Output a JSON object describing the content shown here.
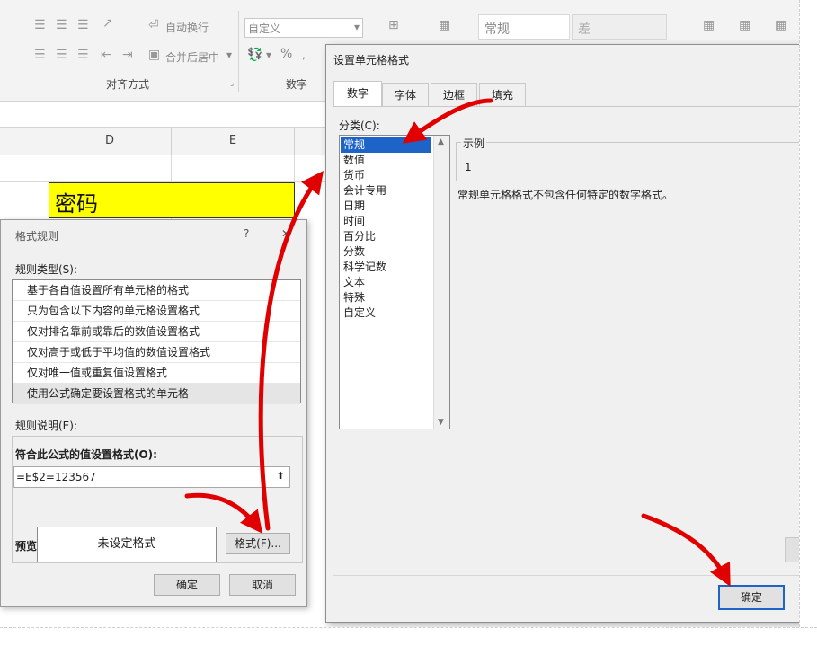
{
  "ribbon": {
    "wrap_text": "自动换行",
    "merge_center": "合并后居中",
    "format_select": "自定义",
    "percent": "%",
    "style_normal": "常规",
    "style_bad": "差",
    "group_alignment": "对齐方式",
    "group_number": "数字"
  },
  "sheet": {
    "columns": [
      "D",
      "E"
    ],
    "cell_d": "密码",
    "cell_fill": "#ffff00"
  },
  "cf_dialog": {
    "title": "格式规则",
    "help": "?",
    "close": "✕",
    "rule_type_label": "规则类型(S):",
    "rule_types": [
      "基于各自值设置所有单元格的格式",
      "只为包含以下内容的单元格设置格式",
      "仅对排名靠前或靠后的数值设置格式",
      "仅对高于或低于平均值的数值设置格式",
      "仅对唯一值或重复值设置格式",
      "使用公式确定要设置格式的单元格"
    ],
    "description_label": "规则说明(E):",
    "formula_label": "符合此公式的值设置格式(O):",
    "formula_value": "=E$2=123567",
    "preview_label": "预览:",
    "preview_text": "未设定格式",
    "format_button": "格式(F)...",
    "ok": "确定",
    "cancel": "取消"
  },
  "fmt_dialog": {
    "title": "设置单元格格式",
    "tabs": [
      "数字",
      "字体",
      "边框",
      "填充"
    ],
    "category_label": "分类(C):",
    "categories": [
      "常规",
      "数值",
      "货币",
      "会计专用",
      "日期",
      "时间",
      "百分比",
      "分数",
      "科学记数",
      "文本",
      "特殊",
      "自定义"
    ],
    "sample_label": "示例",
    "sample_value": "1",
    "description": "常规单元格格式不包含任何特定的数字格式。",
    "ok": "确定"
  },
  "colors": {
    "selection": "#1e64c8",
    "arrow": "#e00000",
    "ok_border": "#1e64c8"
  }
}
